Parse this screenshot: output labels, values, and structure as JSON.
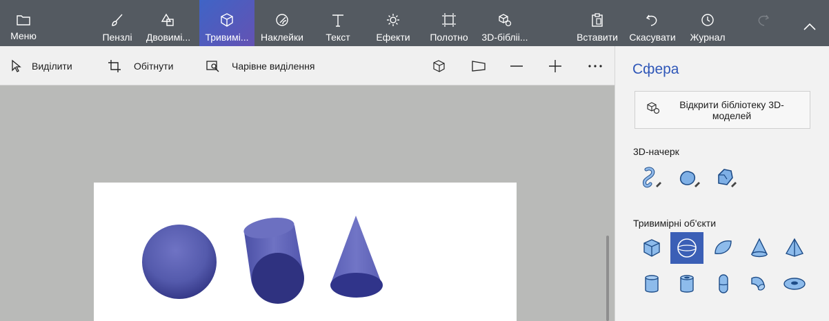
{
  "ribbon": {
    "menu": "Меню",
    "brushes": "Пензлі",
    "shapes2d": "Двовимі...",
    "shapes3d": "Тривимі...",
    "stickers": "Наклейки",
    "text": "Текст",
    "effects": "Ефекти",
    "canvas": "Полотно",
    "library3d": "3D-бібліі...",
    "paste": "Вставити",
    "undo": "Скасувати",
    "history": "Журнал"
  },
  "toolbar": {
    "select": "Виділити",
    "crop": "Обітнути",
    "magic_select": "Чарівне виділення"
  },
  "panel": {
    "title": "Сфера",
    "library_button": "Відкрити бібліотеку 3D-моделей",
    "sketch_section": "3D-начерк",
    "objects_section": "Тривимірні об'єкти",
    "selected_object": "sphere"
  },
  "icons": {
    "sketch": [
      "sharp-edge-doodle-icon",
      "soft-edge-doodle-icon",
      "tube-doodle-icon"
    ],
    "objects": [
      "cube-icon",
      "sphere-icon",
      "hemisphere-icon",
      "cone-icon",
      "pyramid-icon",
      "cylinder-icon",
      "tube-icon",
      "capsule-icon",
      "bend-icon",
      "donut-icon"
    ]
  },
  "colors": {
    "accent": "#3b5fb6",
    "ribbon": "#545a61",
    "shape": "#4a4fa8"
  }
}
